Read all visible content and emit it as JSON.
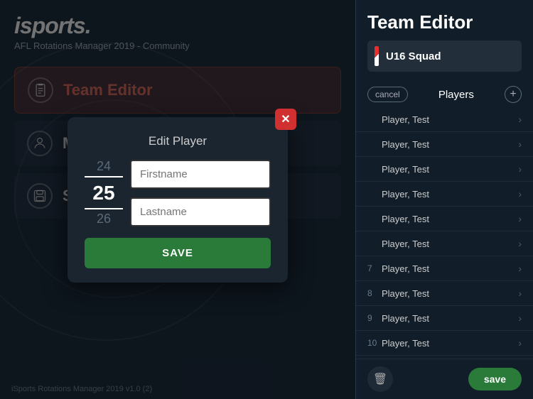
{
  "app": {
    "logo": "isports.",
    "subtitle": "AFL Rotations Manager 2019 - Community",
    "status_bar": "iSports Rotations Manager 2019 v1.0 (2)"
  },
  "nav": {
    "items": [
      {
        "id": "team-editor",
        "label": "Team Editor",
        "icon": "clipboard-icon",
        "active": true
      },
      {
        "id": "matchday",
        "label": "Matchday",
        "icon": "person-icon",
        "active": false
      },
      {
        "id": "saved-games",
        "label": "Saved Gar...",
        "icon": "save-icon",
        "active": false
      }
    ]
  },
  "right_panel": {
    "title": "Team Editor",
    "squad": {
      "name": "U16 Squad"
    },
    "toolbar": {
      "cancel_label": "cancel",
      "players_label": "Players",
      "add_icon": "+"
    },
    "players": [
      {
        "num": "",
        "name": "Player, Test"
      },
      {
        "num": "",
        "name": "Player, Test"
      },
      {
        "num": "",
        "name": "Player, Test"
      },
      {
        "num": "",
        "name": "Player, Test"
      },
      {
        "num": "",
        "name": "Player, Test"
      },
      {
        "num": "",
        "name": "Player, Test"
      },
      {
        "num": "7",
        "name": "Player, Test"
      },
      {
        "num": "8",
        "name": "Player, Test"
      },
      {
        "num": "9",
        "name": "Player, Test"
      },
      {
        "num": "10",
        "name": "Player, Test"
      }
    ],
    "footer": {
      "delete_icon": "🗑",
      "save_label": "save"
    }
  },
  "modal": {
    "title": "Edit Player",
    "close_icon": "✕",
    "numbers": {
      "prev": "24",
      "current": "25",
      "next": "26"
    },
    "fields": {
      "firstname_placeholder": "Firstname",
      "lastname_placeholder": "Lastname"
    },
    "save_label": "SAVE"
  }
}
